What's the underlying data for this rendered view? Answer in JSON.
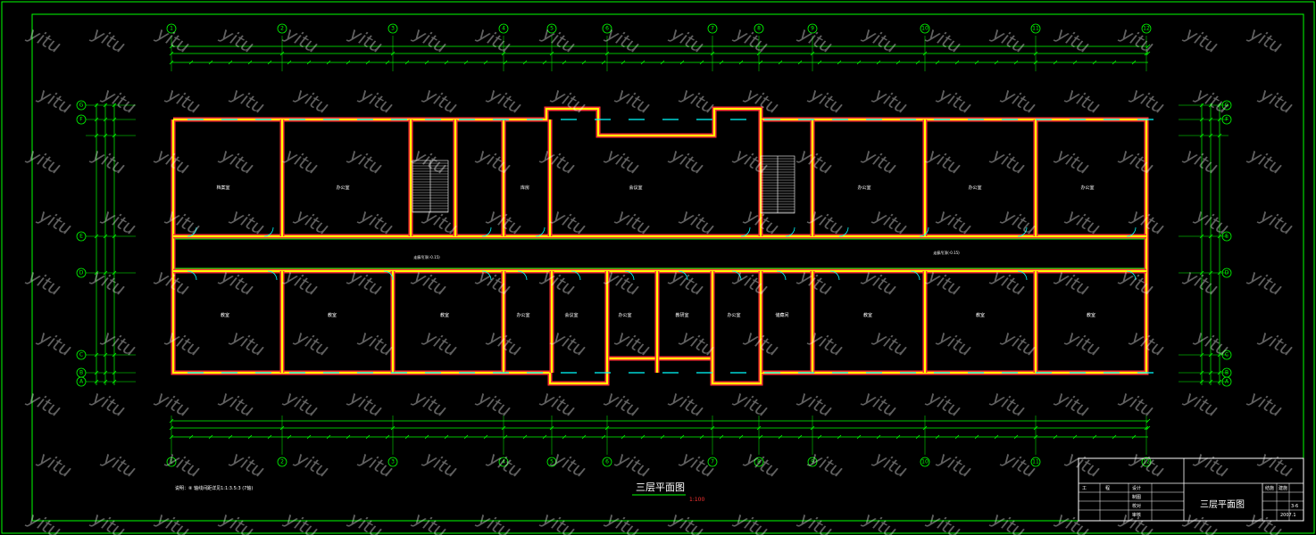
{
  "drawing": {
    "title": "三层平面图",
    "scale": "1:100",
    "note": "说明：⑧ 轴线间距详见1:1:3.5:3 (7轴)"
  },
  "title_block": {
    "drawing_name": "三层平面图",
    "cells": [
      "工",
      "程",
      "设计",
      "制图",
      "校对",
      "审核",
      "结施",
      "建施",
      "3-6",
      "2007.1"
    ]
  },
  "axes": {
    "horizontal": [
      "1",
      "2",
      "3",
      "4",
      "5",
      "6",
      "7",
      "8",
      "9",
      "10",
      "11",
      "12"
    ],
    "vertical": [
      "A",
      "B",
      "C",
      "D",
      "E",
      "F",
      "G"
    ]
  },
  "rooms": {
    "top": [
      "档案室",
      "办公室",
      "库房",
      "会议室",
      "办公室",
      "办公室",
      "办公室"
    ],
    "bottom": [
      "教室",
      "教室",
      "教室",
      "办公室",
      "会议室",
      "办公室",
      "教研室",
      "办公室",
      "储藏间",
      "教室",
      "教室",
      "教室"
    ]
  },
  "corridor_labels": [
    "走廊吊顶(-0.15)",
    "走廊吊顶(-0.15)"
  ],
  "watermark": "yitu",
  "colors": {
    "background": "#000000",
    "frame": "#00ff00",
    "wall": "#ffff00",
    "wall_outline": "#ff3333",
    "dimension": "#00ff00",
    "text": "#ffffff",
    "door": "#00ffff"
  }
}
